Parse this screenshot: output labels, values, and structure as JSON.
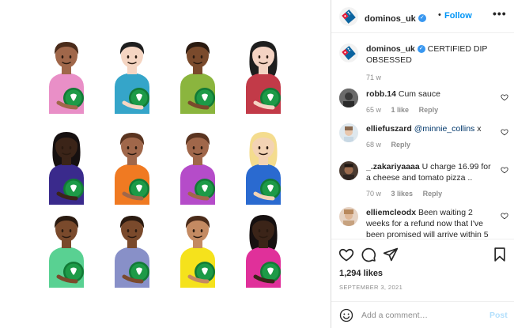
{
  "post": {
    "author": "dominos_uk",
    "follow_label": "Follow",
    "separator": "•",
    "more_label": "•••",
    "caption_text": "CERTIFIED DIP OBSESSED",
    "caption_age": "71 w",
    "likes": "1,294 likes",
    "date": "SEPTEMBER 3, 2021"
  },
  "brand_colors": {
    "dominos_blue": "#0b64a0",
    "dominos_red": "#e31837",
    "verified": "#3897f0",
    "link": "#0095f6"
  },
  "emoji_grid": [
    {
      "skin": "#a0674a",
      "hair": "#4a2b1a",
      "shirt": "#e98fc7"
    },
    {
      "skin": "#f5d5c2",
      "hair": "#1e1e1e",
      "shirt": "#35a5c9"
    },
    {
      "skin": "#7a4a2c",
      "hair": "#2a1a10",
      "shirt": "#8bb53e"
    },
    {
      "skin": "#f4d3c3",
      "hair": "#1e1e1e",
      "shirt": "#c23a48"
    },
    {
      "skin": "#3b2418",
      "hair": "#161010",
      "shirt": "#3a2a8c"
    },
    {
      "skin": "#a0674a",
      "hair": "#5a3420",
      "shirt": "#f07a22"
    },
    {
      "skin": "#a0674a",
      "hair": "#5a3420",
      "shirt": "#b54cc9"
    },
    {
      "skin": "#f3d3b4",
      "hair": "#f4dc8e",
      "shirt": "#2a6ad0"
    },
    {
      "skin": "#7a4a2c",
      "hair": "#2a1a10",
      "shirt": "#59d192"
    },
    {
      "skin": "#7a4a2c",
      "hair": "#2a1a10",
      "shirt": "#8890c8"
    },
    {
      "skin": "#c48a62",
      "hair": "#4a2b1a",
      "shirt": "#f5e21c"
    },
    {
      "skin": "#3b2418",
      "hair": "#161010",
      "shirt": "#e0309a"
    }
  ],
  "comments": [
    {
      "user": "robb.14",
      "text": "Cum sauce",
      "age": "65 w",
      "likes": "1 like",
      "reply": "Reply",
      "avatar": "#5a5a5a"
    },
    {
      "user": "elliefuszard",
      "mention": "@minnie_collins",
      "text": "x",
      "age": "68 w",
      "reply": "Reply",
      "avatar": "#d7e3ea"
    },
    {
      "user": "_.zakariyaaaa",
      "text": "U charge 16.99 for a cheese and tomato pizza ..",
      "age": "70 w",
      "likes": "3 likes",
      "reply": "Reply",
      "avatar": "#7a5a48"
    },
    {
      "user": "elliemcleodx",
      "text": "Been waiting 2 weeks for a refund now that I've been promised will arrive within 5",
      "avatar": "#c9a48a"
    }
  ],
  "add_comment": {
    "placeholder": "Add a comment…",
    "post_label": "Post"
  },
  "icons": [
    "heart-icon",
    "comment-icon",
    "share-icon",
    "bookmark-icon",
    "smiley-icon",
    "verified-icon",
    "more-icon"
  ]
}
